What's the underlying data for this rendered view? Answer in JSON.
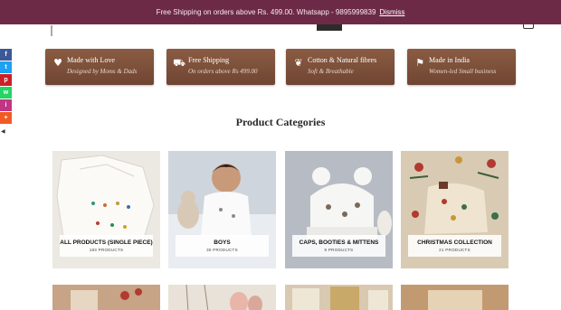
{
  "announcement": {
    "text": "Free Shipping on orders above Rs. 499.00. Whatsapp - 9895999839",
    "dismiss_label": "Dismiss"
  },
  "features": [
    {
      "icon": "heart-icon",
      "glyph": "♥",
      "title": "Made with Love",
      "subtitle": "Designed by Moms & Dads"
    },
    {
      "icon": "truck-icon",
      "glyph": "⛟",
      "title": "Free Shipping",
      "subtitle": "On orders above Rs 499.00"
    },
    {
      "icon": "leaf-icon",
      "glyph": "❦",
      "title": "Cotton & Natural fibres",
      "subtitle": "Soft & Breathable"
    },
    {
      "icon": "flag-icon",
      "glyph": "⚑",
      "title": "Made in India",
      "subtitle": "Women-led Small business"
    }
  ],
  "social": [
    {
      "name": "facebook-icon",
      "glyph": "f",
      "color": "#3b5998"
    },
    {
      "name": "twitter-icon",
      "glyph": "t",
      "color": "#1da1f2"
    },
    {
      "name": "pinterest-icon",
      "glyph": "p",
      "color": "#cb2027"
    },
    {
      "name": "whatsapp-icon",
      "glyph": "w",
      "color": "#25d366"
    },
    {
      "name": "instagram-icon",
      "glyph": "i",
      "color": "#c13584"
    },
    {
      "name": "more-icon",
      "glyph": "+",
      "color": "#f15a24"
    }
  ],
  "hide_toggle": "◀",
  "section_title": "Product Categories",
  "categories": [
    {
      "name": "ALL PRODUCTS (SINGLE PIECE)",
      "count": "183 PRODUCTS"
    },
    {
      "name": "BOYS",
      "count": "30 PRODUCTS"
    },
    {
      "name": "CAPS, BOOTIES & MITTENS",
      "count": "9 PRODUCTS"
    },
    {
      "name": "CHRISTMAS COLLECTION",
      "count": "21 PRODUCTS"
    }
  ],
  "colors": {
    "announcement_bg": "#6d2a47",
    "feature_bg": "#7c4f3a"
  }
}
